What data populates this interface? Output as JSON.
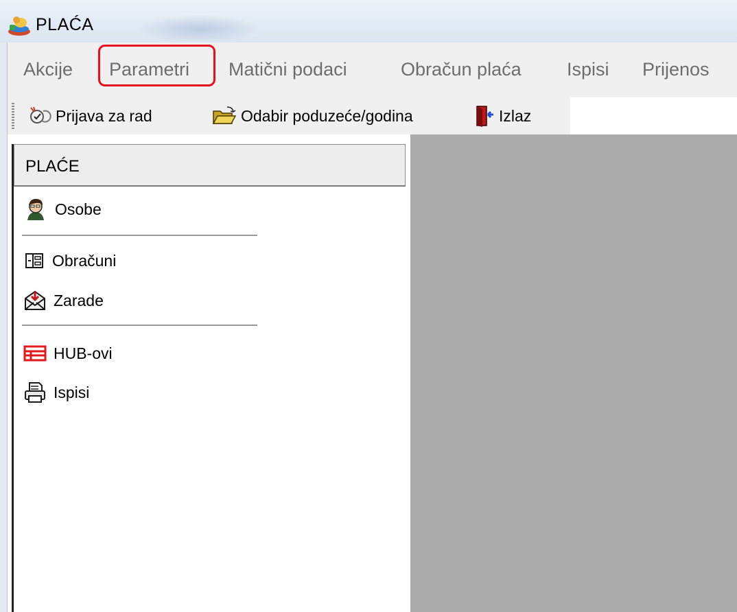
{
  "window": {
    "title": "PLAĆA",
    "app_icon": "app-icon"
  },
  "menu": {
    "items": [
      "Akcije",
      "Parametri",
      "Matični podaci",
      "Obračun plaća",
      "Ispisi",
      "Prijenos"
    ],
    "highlighted": "Parametri",
    "highlight_color": "#e8101d"
  },
  "toolbar": {
    "buttons": [
      {
        "label": "Prijava za rad",
        "icon": "login-icon"
      },
      {
        "label": "Odabir poduzeće/godina",
        "icon": "folder-open-icon"
      },
      {
        "label": "Izlaz",
        "icon": "exit-door-icon"
      }
    ]
  },
  "panel": {
    "header": "PLAĆE",
    "items": [
      {
        "label": "Osobe",
        "icon": "person-icon"
      },
      {
        "label": "Obračuni",
        "icon": "calculation-icon"
      },
      {
        "label": "Zarade",
        "icon": "envelope-icon"
      },
      {
        "label": "HUB-ovi",
        "icon": "hub-icon"
      },
      {
        "label": "Ispisi",
        "icon": "printer-icon"
      }
    ]
  },
  "colors": {
    "workspace": "#ababab",
    "menubar": "#f0f0f0",
    "menu_text": "#6d6d6d"
  }
}
